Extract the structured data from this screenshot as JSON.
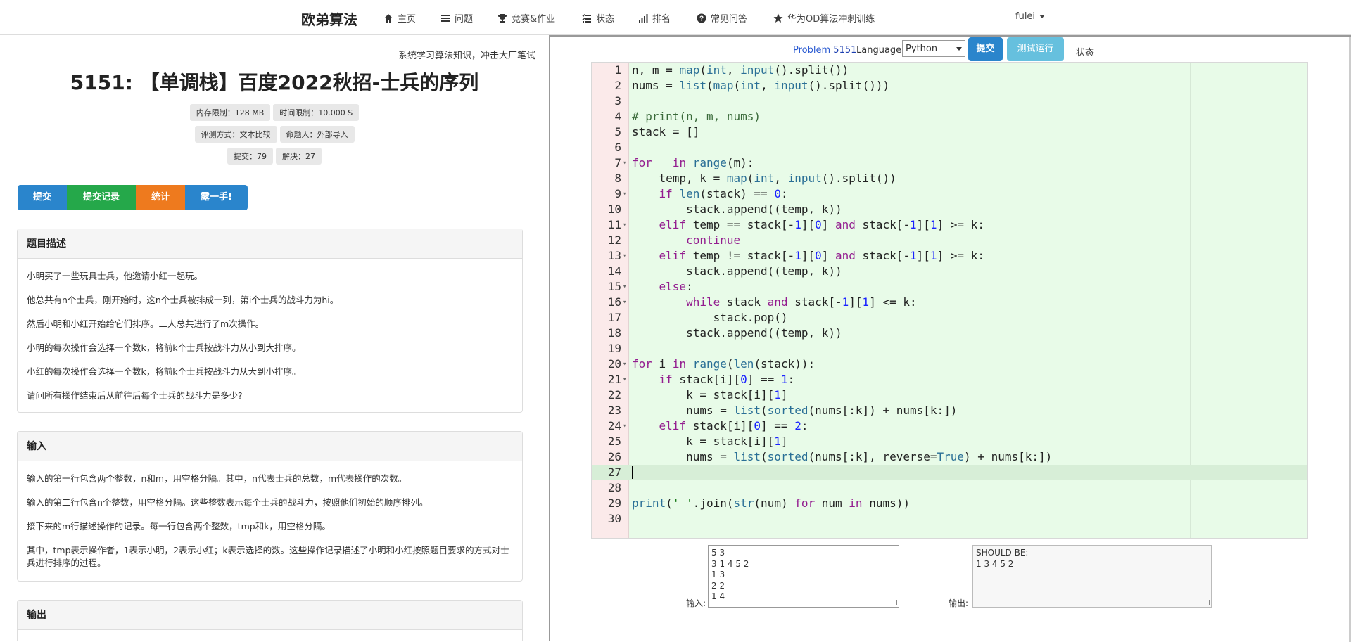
{
  "navbar": {
    "brand": "欧弟算法",
    "items": [
      {
        "label": "主页",
        "icon": "home-icon"
      },
      {
        "label": "问题",
        "icon": "list-icon"
      },
      {
        "label": "竞赛&作业",
        "icon": "trophy-icon"
      },
      {
        "label": "状态",
        "icon": "status-list-icon"
      },
      {
        "label": "排名",
        "icon": "bar-chart-icon"
      },
      {
        "label": "常见问答",
        "icon": "question-circle-icon"
      },
      {
        "label": "华为OD算法冲刺训练",
        "icon": "star-icon"
      }
    ],
    "user": "fulei"
  },
  "problem": {
    "marquee": "系统学习算法知识，冲击大厂笔试",
    "title": "5151: 【单调栈】百度2022秋招-士兵的序列",
    "memory_limit": "内存限制：128 MB",
    "time_limit": "时间限制：10.000 S",
    "judge_method": "评测方式：文本比较",
    "author": "命题人：外部导入",
    "submissions": "提交：79",
    "solved": "解决：27",
    "buttons": {
      "submit": "提交",
      "records": "提交记录",
      "stats": "统计",
      "hack": "露一手!"
    },
    "sections": {
      "description": {
        "heading": "题目描述",
        "paragraphs": [
          "小明买了一些玩具士兵，他邀请小红一起玩。",
          "他总共有n个士兵，刚开始时，这n个士兵被排成一列，第i个士兵的战斗力为hi。",
          "然后小明和小红开始给它们排序。二人总共进行了m次操作。",
          "小明的每次操作会选择一个数k，将前k个士兵按战斗力从小到大排序。",
          "小红的每次操作会选择一个数k，将前k个士兵按战斗力从大到小排序。",
          "请问所有操作结束后从前往后每个士兵的战斗力是多少?"
        ]
      },
      "input": {
        "heading": "输入",
        "paragraphs": [
          "输入的第一行包含两个整数，n和m，用空格分隔。其中，n代表士兵的总数，m代表操作的次数。",
          "输入的第二行包含n个整数，用空格分隔。这些整数表示每个士兵的战斗力，按照他们初始的顺序排列。",
          "接下来的m行描述操作的记录。每一行包含两个整数，tmp和k，用空格分隔。",
          "其中，tmp表示操作者，1表示小明，2表示小红；k表示选择的数。这些操作记录描述了小明和小红按照题目要求的方式对士兵进行排序的过程。"
        ]
      },
      "output": {
        "heading": "输出"
      }
    }
  },
  "editor": {
    "problem_label": "Problem",
    "problem_id": "5151",
    "language_label": "Language:",
    "language": "Python",
    "submit": "提交",
    "test_run": "测试运行",
    "status": "状态",
    "active_line": 27,
    "lines": [
      "n, m = map(int, input().split())",
      "nums = list(map(int, input().split()))",
      "",
      "# print(n, m, nums)",
      "stack = []",
      "",
      "for _ in range(m):",
      "    temp, k = map(int, input().split())",
      "    if len(stack) == 0:",
      "        stack.append((temp, k))",
      "    elif temp == stack[-1][0] and stack[-1][1] >= k:",
      "        continue",
      "    elif temp != stack[-1][0] and stack[-1][1] >= k:",
      "        stack.append((temp, k))",
      "    else:",
      "        while stack and stack[-1][1] <= k:",
      "            stack.pop()",
      "        stack.append((temp, k))",
      "",
      "for i in range(len(stack)):",
      "    if stack[i][0] == 1:",
      "        k = stack[i][1]",
      "        nums = list(sorted(nums[:k]) + nums[k:])",
      "    elif stack[i][0] == 2:",
      "        k = stack[i][1]",
      "        nums = list(sorted(nums[:k], reverse=True) + nums[k:])",
      "",
      "",
      "print(' '.join(str(num) for num in nums))",
      ""
    ],
    "fold_lines": [
      7,
      9,
      11,
      13,
      15,
      16,
      20,
      21,
      24
    ]
  },
  "io": {
    "input_label": "输入:",
    "input_value": "5 3\n3 1 4 5 2\n1 3\n2 2\n1 4",
    "output_label": "输出:",
    "output_value": "SHOULD BE:\n1 3 4 5 2"
  }
}
